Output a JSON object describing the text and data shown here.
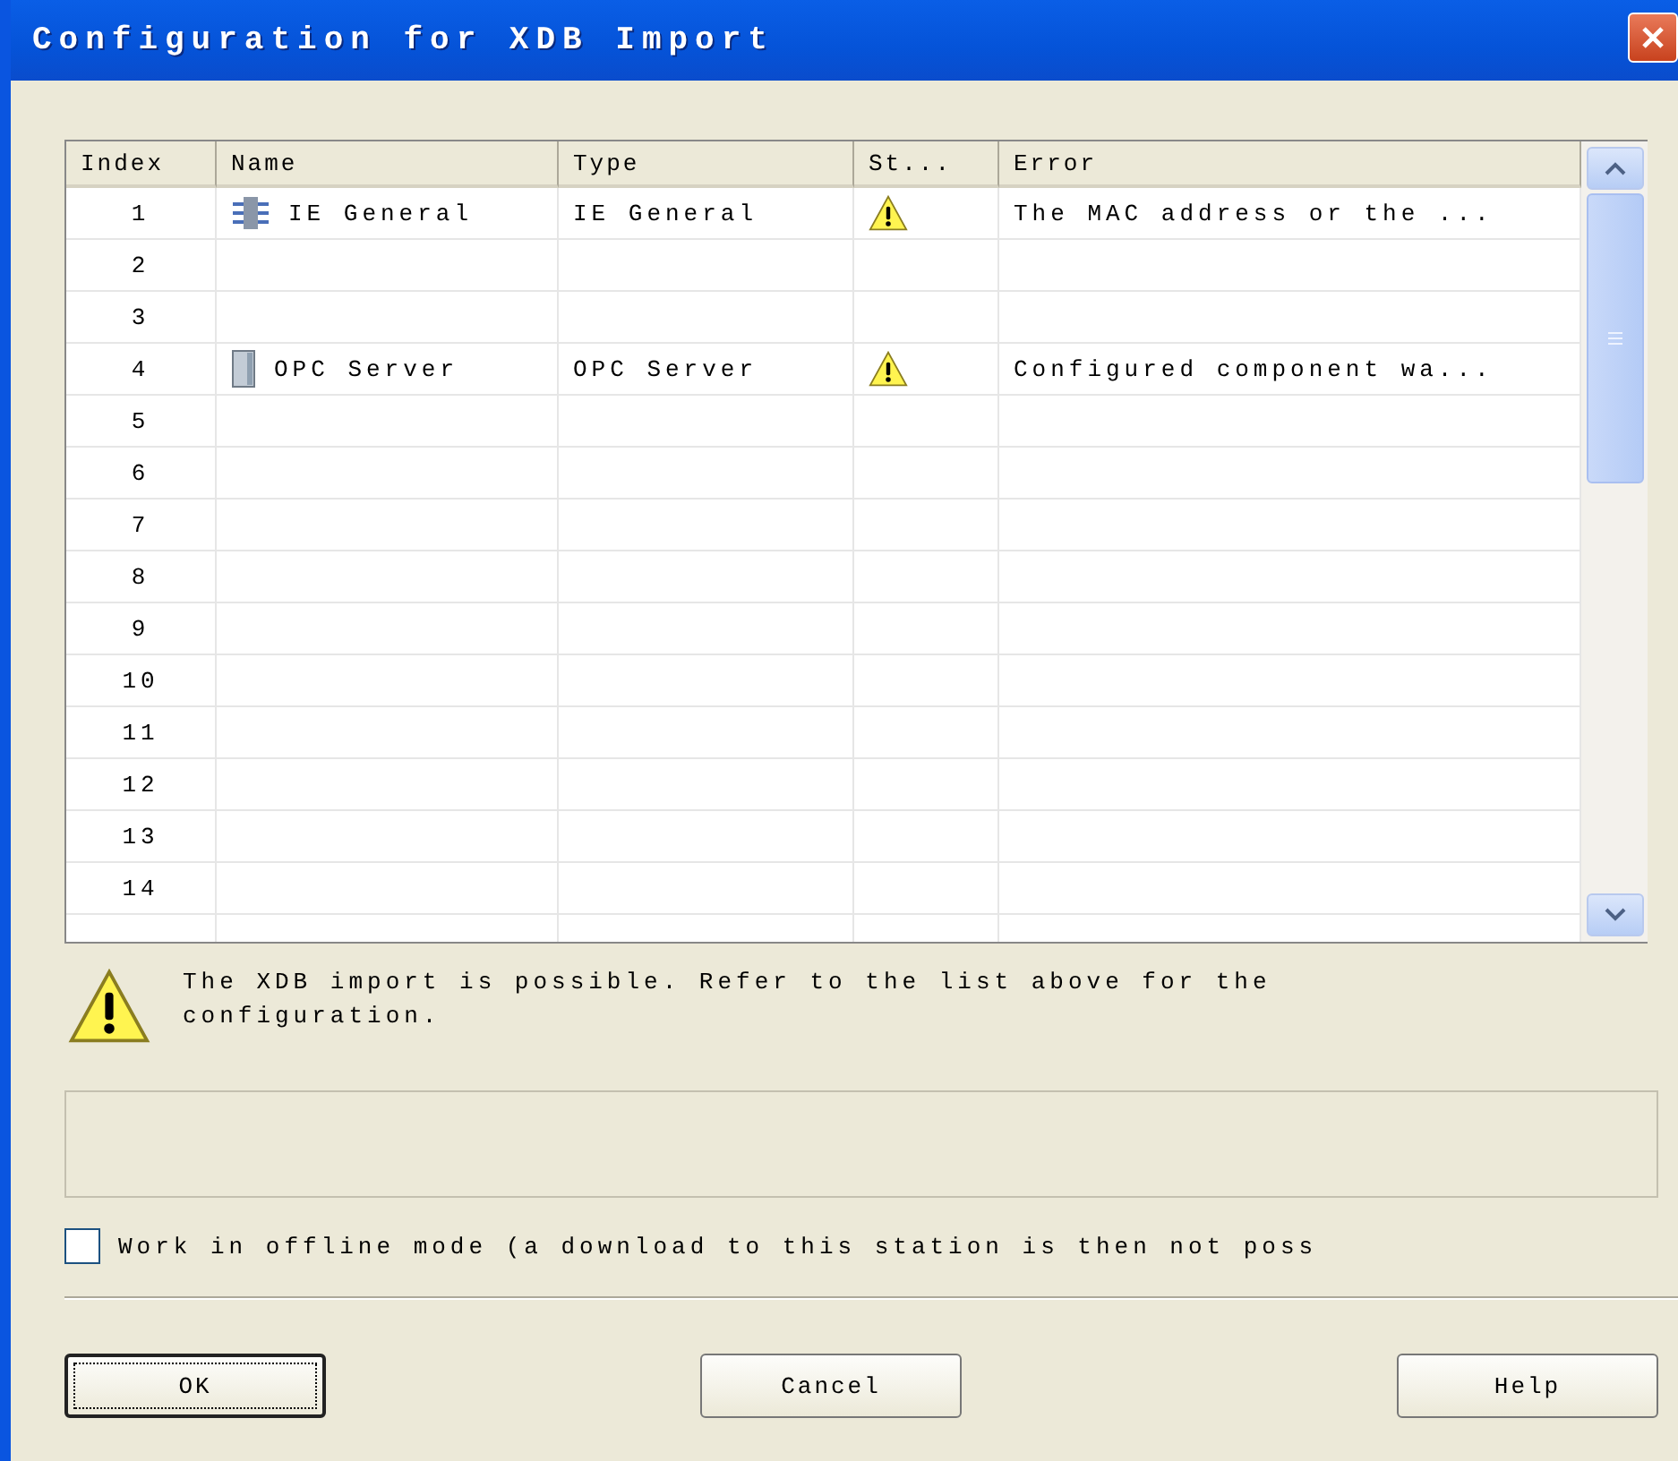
{
  "window": {
    "title": "Configuration for XDB Import"
  },
  "table": {
    "columns": [
      "Index",
      "Name",
      "Type",
      "St...",
      "Error"
    ],
    "rows": [
      {
        "index": "1",
        "kind": "network",
        "name": "IE General",
        "type": "IE General",
        "warning": true,
        "error": "The MAC address or the ..."
      },
      {
        "index": "2",
        "warning": false
      },
      {
        "index": "3",
        "warning": false
      },
      {
        "index": "4",
        "kind": "server",
        "name": "OPC Server",
        "type": "OPC Server",
        "warning": true,
        "error": "Configured component wa..."
      },
      {
        "index": "5",
        "warning": false
      },
      {
        "index": "6",
        "warning": false
      },
      {
        "index": "7",
        "warning": false
      },
      {
        "index": "8",
        "warning": false
      },
      {
        "index": "9",
        "warning": false
      },
      {
        "index": "10",
        "warning": false
      },
      {
        "index": "11",
        "warning": false
      },
      {
        "index": "12",
        "warning": false
      },
      {
        "index": "13",
        "warning": false
      },
      {
        "index": "14",
        "warning": false
      }
    ]
  },
  "message": {
    "kind": "warning",
    "text": "The XDB import is possible. Refer to the list above for the configuration."
  },
  "offline": {
    "label": "Work in offline mode (a download to this station is then not poss",
    "checked": false
  },
  "buttons": [
    {
      "label": "OK",
      "default": true
    },
    {
      "label": "Cancel",
      "default": false
    },
    {
      "label": "Help",
      "default": false
    }
  ]
}
